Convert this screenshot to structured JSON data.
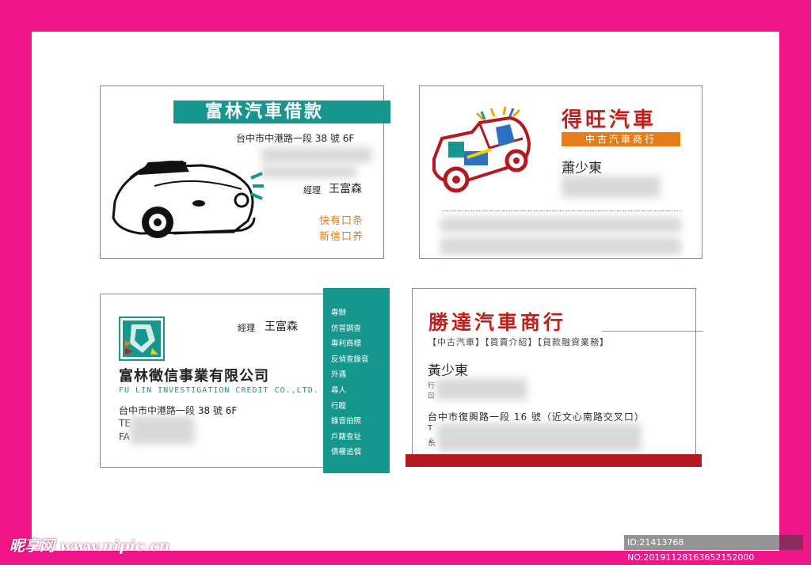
{
  "colors": {
    "page_border": "#f0168a",
    "teal": "#17968e",
    "orange": "#e57c17",
    "red": "#c0201c",
    "dark_red": "#b3191e"
  },
  "card1": {
    "title": "富林汽車借款",
    "address": "台中市中港路一段 38 號 6F",
    "role": "經理",
    "name": "王富森",
    "stamp_line1": "快有口条",
    "stamp_line2": "新信口养",
    "icon": "convertible-car-icon"
  },
  "card2": {
    "title": "得旺汽車",
    "subtitle": "中古汽車商行",
    "name": "蕭少東",
    "icon": "colorful-car-icon"
  },
  "card3": {
    "role": "經理",
    "name": "王富森",
    "company": "富林徵信事業有限公司",
    "company_en": "FU LIN INVESTIGATION CREDIT CO.,LTD.",
    "address": "台中市中港路一段 38 號 6F",
    "tel_prefix": "TE",
    "fax_prefix": "FA",
    "services": [
      "專辦",
      "仿冒調查",
      "專利商標",
      "反偵查錄音",
      "外遇",
      "尋人",
      "行蹤",
      "錄音拍照",
      "戶籍查址",
      "債權追償"
    ],
    "icon": "investigation-logo-icon"
  },
  "card4": {
    "title": "勝達汽車商行",
    "tags": "【中古汽車】【買賣介紹】【貸款融資業務】",
    "name": "黃少東",
    "row_a": "行",
    "row_b": "ㄖ",
    "address": "台中市復興路一段 16 號（近文心南路交叉口）",
    "row_c": "T",
    "row_d": "糸"
  },
  "watermark": {
    "left": "昵享网 www.nipic.cn",
    "right": "ID:21413768 NO:20191128163652152000"
  }
}
